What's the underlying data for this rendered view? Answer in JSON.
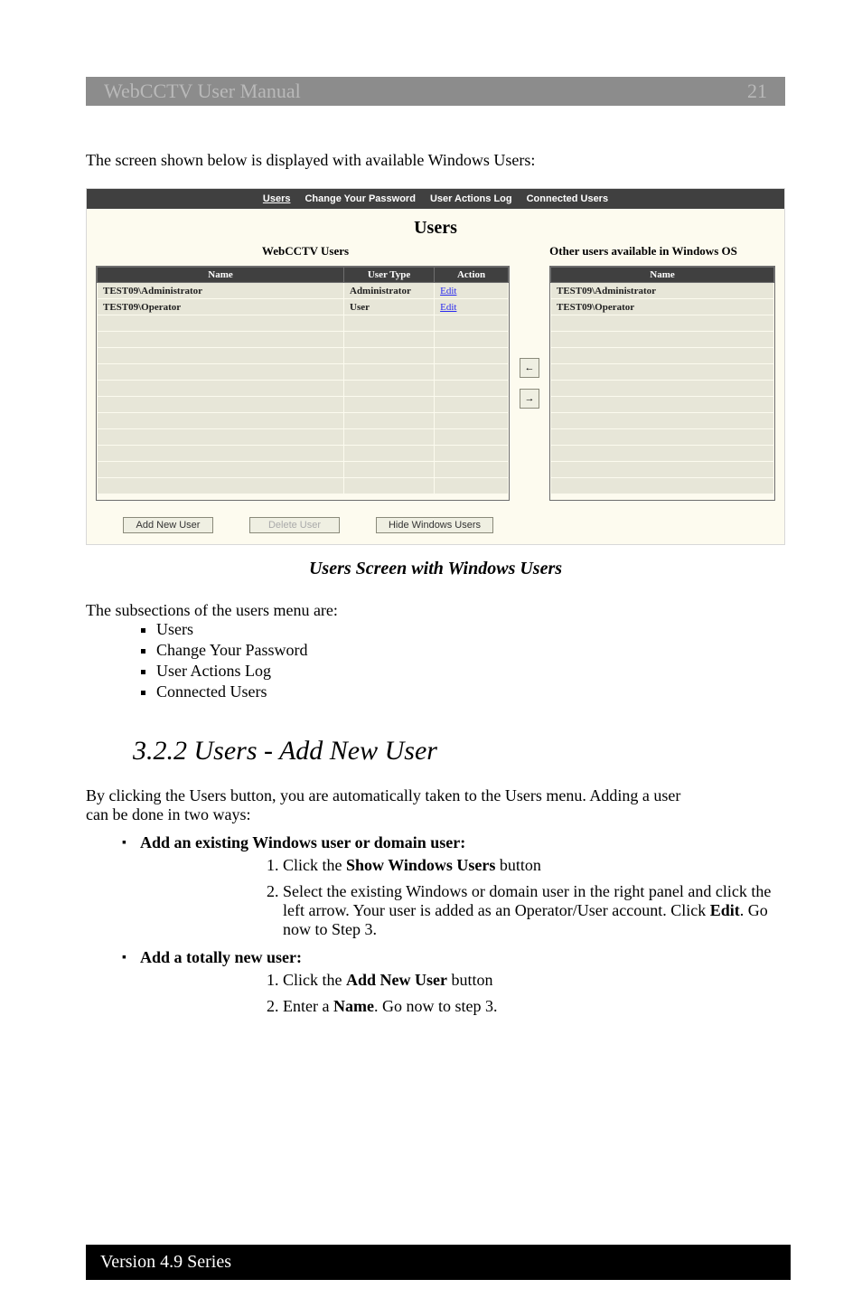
{
  "header": {
    "title_left": "WebCCTV User Manual",
    "page_number": "21"
  },
  "intro": "The screen shown below is displayed with available Windows Users:",
  "screenshot": {
    "tabs": [
      "Users",
      "Change Your Password",
      "User Actions Log",
      "Connected Users"
    ],
    "panel_title": "Users",
    "left_title": "WebCCTV Users",
    "right_title": "Other users available in Windows OS",
    "left_headers": [
      "Name",
      "User Type",
      "Action"
    ],
    "right_headers": [
      "Name"
    ],
    "left_rows": [
      {
        "name": "TEST09\\Administrator",
        "type": "Administrator",
        "action": "Edit"
      },
      {
        "name": "TEST09\\Operator",
        "type": "User",
        "action": "Edit"
      }
    ],
    "right_rows": [
      {
        "name": "TEST09\\Administrator"
      },
      {
        "name": "TEST09\\Operator"
      }
    ],
    "arrow_left": "←",
    "arrow_right": "→",
    "buttons": {
      "add": "Add New User",
      "delete": "Delete User",
      "hide": "Hide Windows Users"
    }
  },
  "caption": "Users Screen with Windows Users",
  "subsections_intro": "The subsections of the users menu are:",
  "subsections": [
    "Users",
    "Change Your Password",
    "User Actions Log",
    "Connected Users"
  ],
  "section_heading": "3.2.2 Users - Add New User",
  "para1a": "By clicking the Users button, you are automatically taken to the Users menu. Adding a user",
  "para1b": "can be done in two ways:",
  "method1_title": "Add an existing Windows user or domain user:",
  "method1_step1_a": "Click the ",
  "method1_step1_b": "Show Windows Users",
  "method1_step1_c": " button",
  "method1_step2_a": "Select the existing Windows or domain user in the right panel and click the left arrow. Your user is added as an Operator/User account. Click ",
  "method1_step2_b": "Edit",
  "method1_step2_c": ". Go now to Step 3.",
  "method2_title": "Add a totally new user:",
  "method2_step1_a": "Click the ",
  "method2_step1_b": "Add New User",
  "method2_step1_c": " button",
  "method2_step2_a": "Enter a ",
  "method2_step2_b": "Name",
  "method2_step2_c": ". Go now to step 3.",
  "footer": "Version 4.9 Series"
}
